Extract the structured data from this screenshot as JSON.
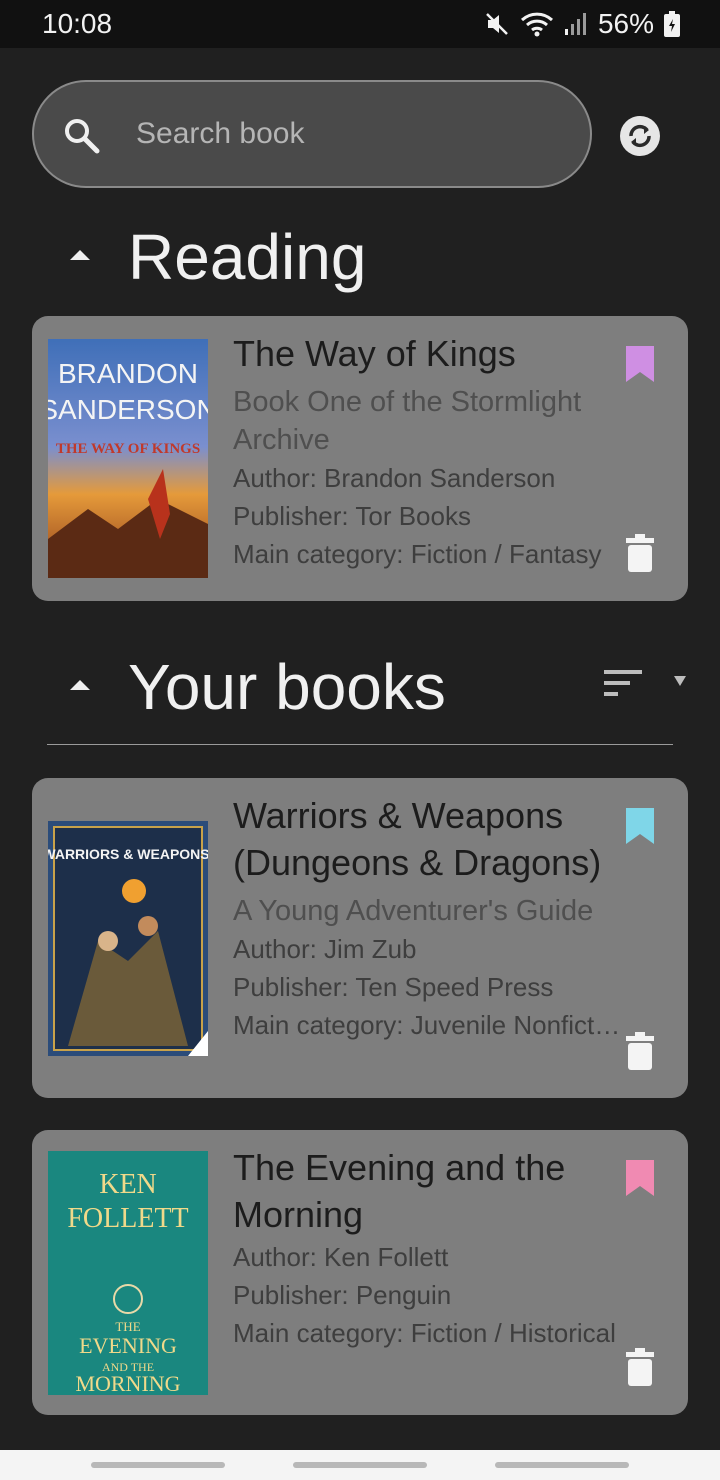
{
  "status": {
    "time": "10:08",
    "battery": "56%"
  },
  "search": {
    "placeholder": "Search book",
    "value": ""
  },
  "sections": {
    "reading": "Reading",
    "your_books": "Your books"
  },
  "reading_books": [
    {
      "title": "The Way of Kings",
      "subtitle": "Book One of the Stormlight Archive",
      "author": "Author: Brandon Sanderson",
      "publisher": "Publisher: Tor Books",
      "category": "Main category: Fiction / Fantasy",
      "bookmark_color": "#cf8fe3",
      "cover_text": [
        "BRANDON",
        "SANDERSON",
        "THE WAY OF KINGS"
      ]
    }
  ],
  "your_books": [
    {
      "title": "Warriors & Weapons (Dungeons & Dragons)",
      "subtitle": "A Young Adventurer's Guide",
      "author": "Author: Jim Zub",
      "publisher": "Publisher: Ten Speed Press",
      "category": "Main category: Juvenile Nonfiction",
      "bookmark_color": "#7fd6e8",
      "cover_text": [
        "WARRIORS & WEAPONS"
      ]
    },
    {
      "title": "The Evening and the Morning",
      "subtitle": "",
      "author": "Author: Ken Follett",
      "publisher": "Publisher: Penguin",
      "category": "Main category: Fiction / Historical",
      "bookmark_color": "#f08ab2",
      "cover_text": [
        "KEN",
        "FOLLETT",
        "THE",
        "EVENING",
        "AND THE",
        "MORNING"
      ]
    }
  ],
  "icons": {
    "search": "search-icon",
    "sync": "sync-icon",
    "collapse": "arrow-up-icon",
    "sort": "sort-icon",
    "filter": "filter-arrow-icon",
    "bookmark": "bookmark-icon",
    "delete": "trash-icon"
  }
}
